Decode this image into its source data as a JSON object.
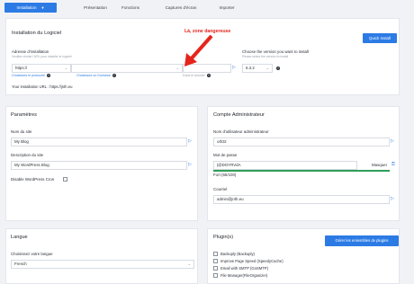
{
  "tabs": [
    {
      "label": "Installation",
      "active": true
    },
    {
      "label": "Présentation"
    },
    {
      "label": "Fonctions"
    },
    {
      "label": "Captures d'écran"
    },
    {
      "label": "Importer"
    }
  ],
  "install_panel": {
    "title": "Installation du Logiciel",
    "quick_install": "Quick Install",
    "address_label": "Adresse d'installation",
    "address_sub": "Veuillez choisir l'URL pour installer le logiciel",
    "protocol": "https://",
    "domain": "",
    "directory": "",
    "protocol_hint": "Choisissez le protocole",
    "domain_hint": "Choisissez un Domaine",
    "directory_hint": "Dans le dossier",
    "current_url_label": "Your installation URL :",
    "current_url": "https://jnth.eu",
    "version_label": "Choose the version you want to install",
    "version_sub": "Please select the version to install",
    "version": "6.3.2",
    "danger_note": "Là, zone dangereuse"
  },
  "settings_panel": {
    "title": "Paramètres",
    "site_name_label": "Nom du site",
    "site_name": "My Blog",
    "site_desc_label": "Description du site",
    "site_desc": "My WordPress Blog",
    "cron_label": "Disable WordPress Cron"
  },
  "admin_panel": {
    "title": "Compte Administrateur",
    "user_label": "Nom d'utilisateur administrateur",
    "user": "oIh3z",
    "pass_label": "Mot de passe",
    "pass": "|@DOYRVdA",
    "mask": "Masquer",
    "strength": "Fort (65/100)",
    "email_label": "Courriel",
    "email": "admin@jnth.eu",
    "strength_color": "#2f9d58"
  },
  "language_panel": {
    "title": "Langue",
    "select_label": "Choisissez votre langue",
    "language": "French"
  },
  "plugins_panel": {
    "title": "Plugin(s)",
    "manage": "Gérer les ensembles de plugins",
    "items": [
      "Backuply (Backuply)",
      "Improve Page Speed (SpeedyCache)",
      "Email with SMTP (GoSMTP)",
      "File Manager(FileOrganizer)"
    ]
  }
}
